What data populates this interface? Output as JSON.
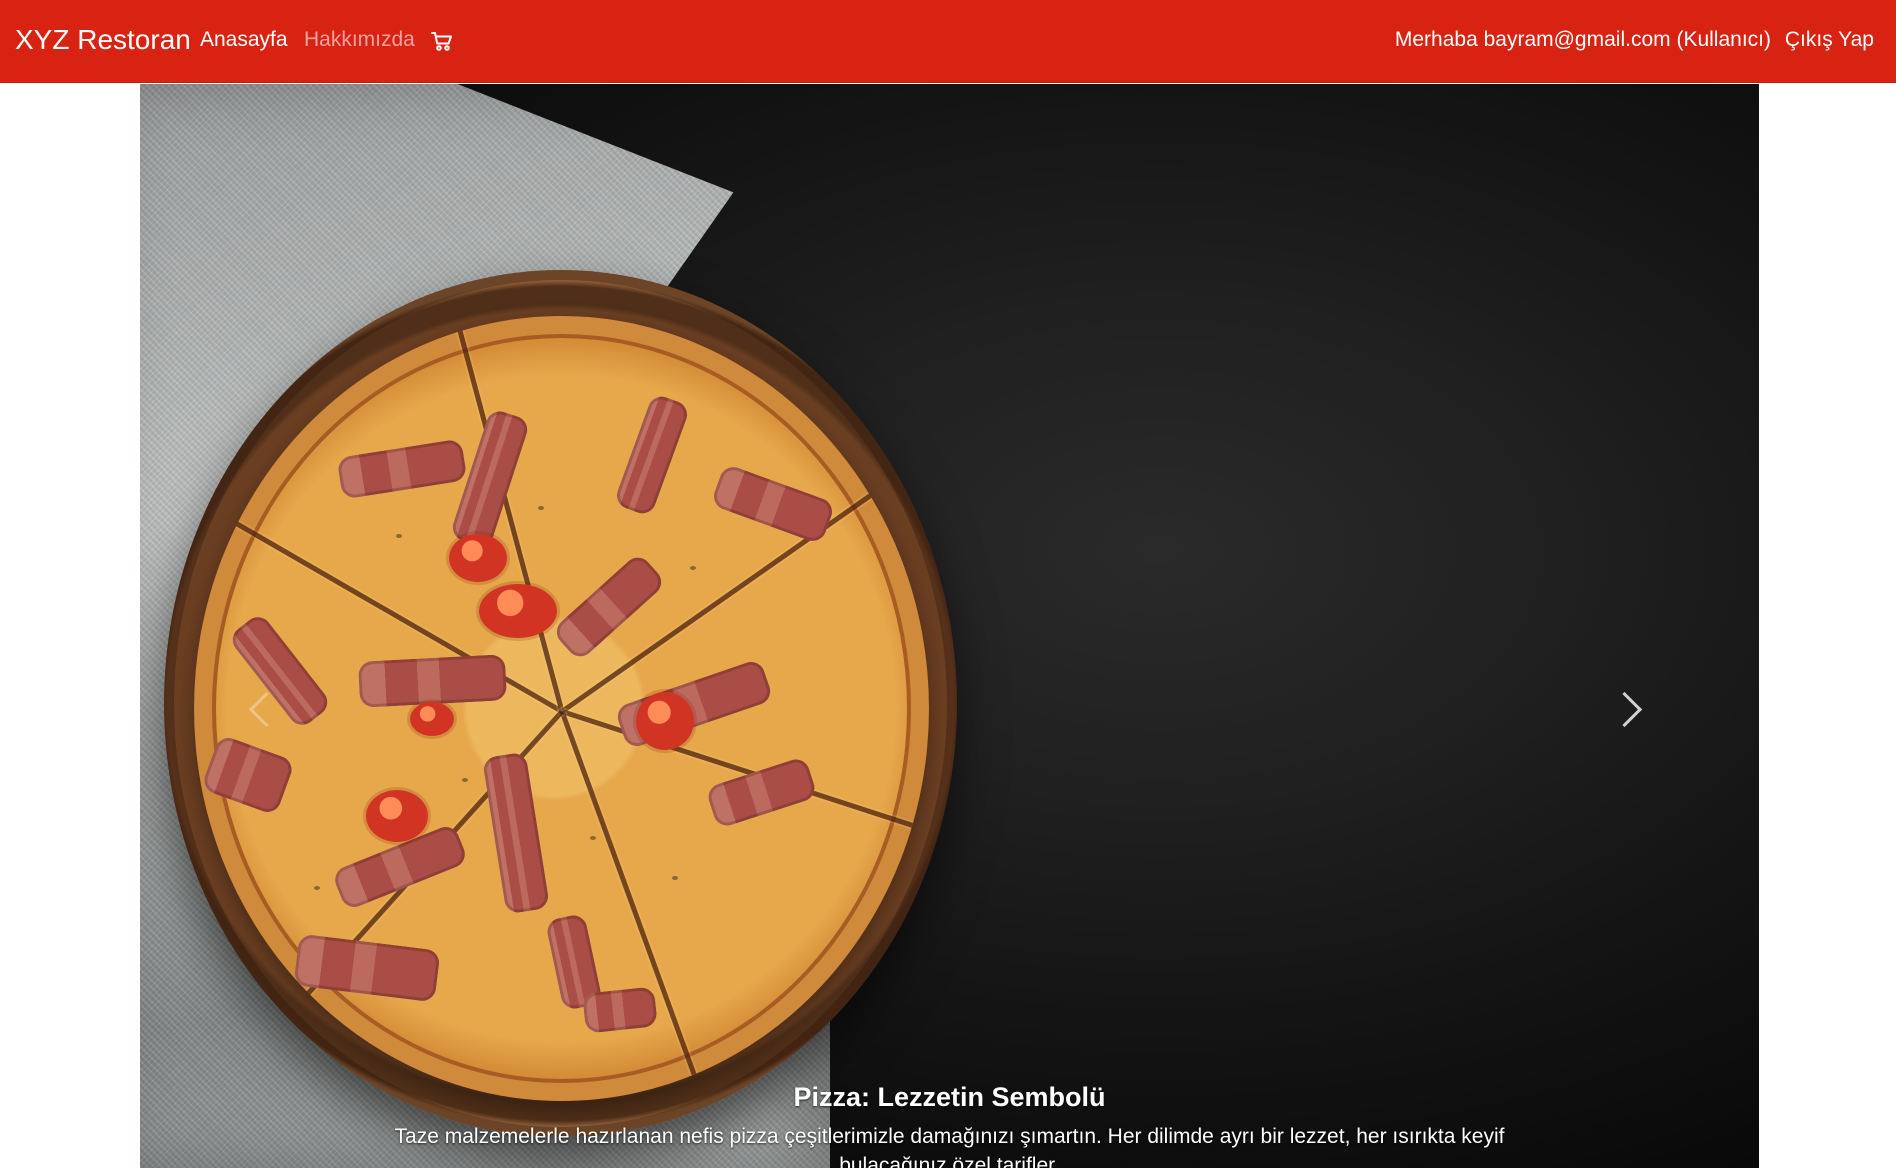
{
  "header": {
    "brand": "XYZ Restoran",
    "nav": [
      {
        "label": "Anasayfa"
      },
      {
        "label": "Hakkımızda"
      }
    ],
    "cart_icon": "shopping-cart-icon",
    "greeting": "Merhaba bayram@gmail.com (Kullanıcı)",
    "logout": "Çıkış Yap"
  },
  "carousel": {
    "active_slide": 1,
    "slide_count": 3,
    "image_subject": "pizza",
    "caption": {
      "title": "Pizza: Lezzetin Sembolü",
      "text": "Taze malzemelerle hazırlanan nefis pizza çeşitlerimizle damağınızı şımartın. Her dilimde ayrı bir lezzet, her ısırıkta keyif bulacağınız özel tarifler."
    },
    "controls": {
      "prev_icon": "chevron-left-icon",
      "next_icon": "chevron-right-icon"
    }
  },
  "colors": {
    "header_red": "#d92312",
    "hover_link": "#f7a1a1",
    "carousel_dark": "#141414",
    "text_white": "#ffffff"
  }
}
